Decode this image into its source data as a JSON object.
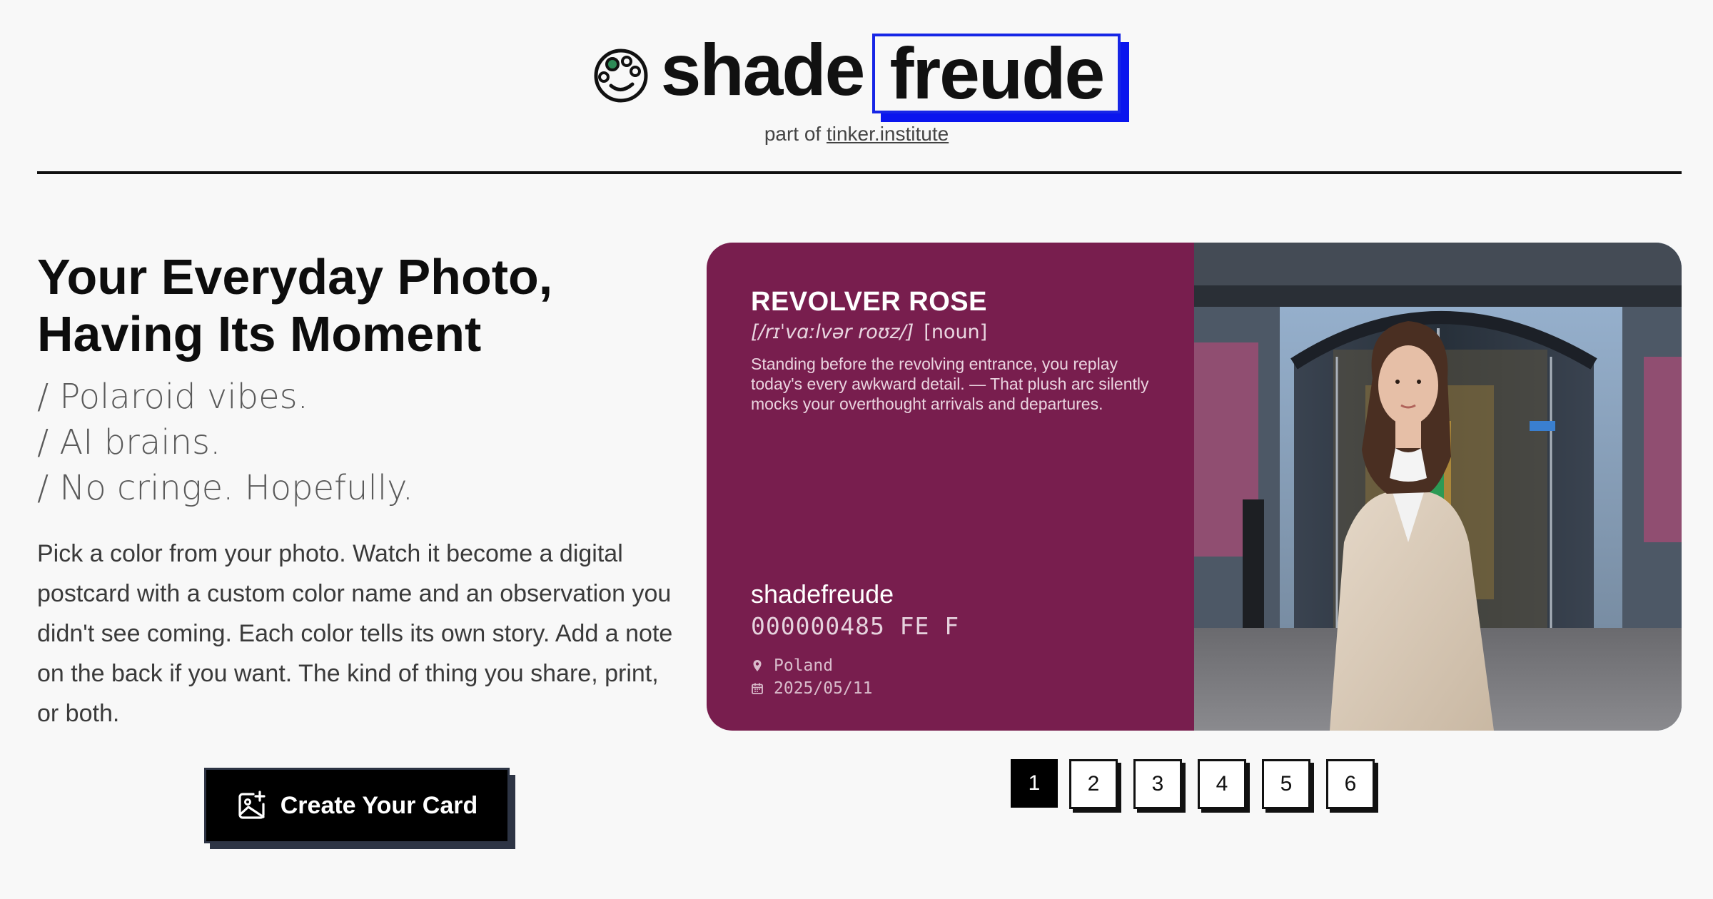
{
  "header": {
    "logo_part1": "shade",
    "logo_part2": "freude",
    "part_of_prefix": "part of",
    "part_of_link": "tinker.institute"
  },
  "hero": {
    "headline_line1": "Your Everyday Photo,",
    "headline_line2": "Having Its Moment",
    "taglines": [
      "/ Polaroid vibes.",
      "/ AI brains.",
      "/ No cringe. Hopefully."
    ],
    "description": "Pick a color from your photo. Watch it become a digital postcard with a custom color name and an observation you didn't see coming. Each color tells its own story. Add a note on the back if you want. The kind of thing you share, print, or both.",
    "cta_label": "Create Your Card"
  },
  "card": {
    "color_hex": "#781e4e",
    "color_name": "REVOLVER ROSE",
    "phonetic": "[/rɪˈvɑːlvər roʊz/]",
    "part_of_speech": "[noun]",
    "description": "Standing before the revolving entrance, you replay today's every awkward detail. — That plush arc silently mocks your overthought arrivals and departures.",
    "brand": "shadefreude",
    "code": "000000485 FE F",
    "location": "Poland",
    "date": "2025/05/11"
  },
  "pagination": {
    "pages": [
      "1",
      "2",
      "3",
      "4",
      "5",
      "6"
    ],
    "active": "1"
  },
  "colors": {
    "accent_blue": "#0a15ee",
    "card_bg": "#781e4e",
    "page_bg": "#f8f8f8"
  }
}
